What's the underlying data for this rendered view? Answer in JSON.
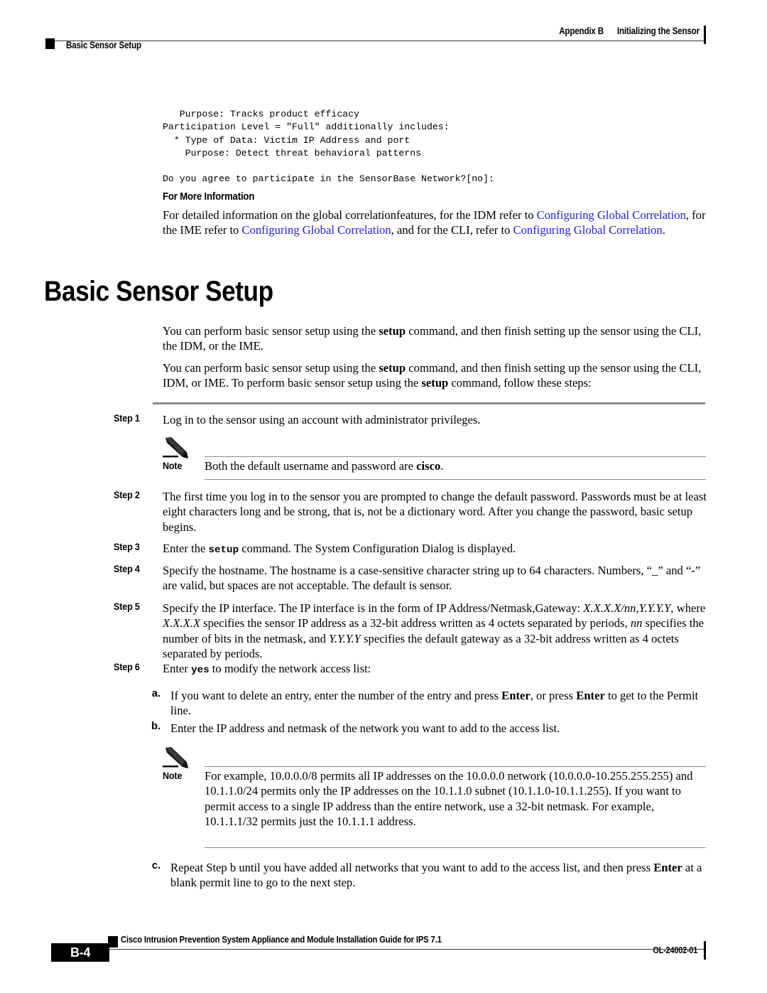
{
  "header": {
    "appendix_label": "Appendix B",
    "appendix_title": "Initializing the Sensor",
    "running_head": "Basic Sensor Setup"
  },
  "code_block": {
    "text": "   Purpose: Tracks product efficacy\nParticipation Level = \"Full\" additionally includes:\n  * Type of Data: Victim IP Address and port\n    Purpose: Detect threat behavioral patterns\n\nDo you agree to participate in the SensorBase Network?[no]:"
  },
  "for_more_information": {
    "heading": "For More Information",
    "text_1": "For detailed information on the global correlationfeatures, for the IDM refer to ",
    "link_1": "Configuring Global Correlation",
    "text_2": ", for the IME refer to ",
    "link_2": "Configuring Global Correlation",
    "text_3": ", and for the CLI, refer to ",
    "link_3": "Configuring Global Correlation",
    "text_4": ".",
    "link_color": "#2222cc"
  },
  "chapter_title": "Basic Sensor Setup",
  "intro": {
    "para_1_a": "You can perform basic sensor setup using the ",
    "para_1_b": "setup",
    "para_1_c": " command, and then finish setting up the sensor using the CLI, the IDM, or the IME.",
    "para_2_a": "You can perform basic sensor setup using the ",
    "para_2_b": "setup",
    "para_2_c": " command, and then finish setting up the sensor using the CLI, IDM, or IME. To perform basic sensor setup using the ",
    "para_2_d": "setup",
    "para_2_e": " command, follow these steps:"
  },
  "steps": {
    "step1": {
      "label": "Step 1",
      "text": "Log in to the sensor using an account with administrator privileges."
    },
    "step2": {
      "label": "Step 2",
      "text": "The first time you log in to the sensor you are prompted to change the default password. Passwords must be at least eight characters long and be strong, that is, not be a dictionary word. After you change the password, basic setup begins."
    },
    "step3": {
      "label": "Step 3",
      "text_a": "Enter the ",
      "text_b": "setup",
      "text_c": " command. The System Configuration Dialog is displayed."
    },
    "step4": {
      "label": "Step 4",
      "text": "Specify the hostname. The hostname is a case-sensitive character string up to 64 characters. Numbers, “_” and “-” are valid, but spaces are not acceptable. The default is sensor."
    },
    "step5": {
      "label": "Step 5",
      "text_a": "Specify the IP interface. The IP interface is in the form of IP Address/Netmask,Gateway: ",
      "italic_1": "X.X.X.X/nn,Y.Y.Y.Y",
      "text_b": ", where ",
      "italic_2": "X.X.X.X",
      "text_c": " specifies the sensor IP address as a 32-bit address written as 4 octets separated by periods, ",
      "italic_3": "nn",
      "text_d": " specifies the number of bits in the netmask, and ",
      "italic_4": "Y.Y.Y.Y",
      "text_e": " specifies the default gateway as a 32-bit address written as 4 octets separated by periods."
    },
    "step6": {
      "label": "Step 6",
      "text_a": "Enter ",
      "text_b": "yes",
      "text_c": " to modify the network access list:"
    }
  },
  "substeps": {
    "a": {
      "label": "a.",
      "text_a": "If you want to delete an entry, enter the number of the entry and press ",
      "text_b": "Enter",
      "text_c": ", or press ",
      "text_d": "Enter",
      "text_e": " to get to the Permit line."
    },
    "b": {
      "label": "b.",
      "text": "Enter the IP address and netmask of the network you want to add to the access list."
    },
    "c": {
      "label": "c.",
      "text_a": "Repeat Step b until you have added all networks that you want to add to the access list, and then press ",
      "text_b": "Enter",
      "text_c": " at a blank permit line to go to the next step."
    }
  },
  "notes": {
    "note1": {
      "label": "Note",
      "icon": "pencil-icon",
      "text_a": "Both the default username and password are ",
      "text_b": "cisco",
      "text_c": "."
    },
    "note2": {
      "label": "Note",
      "icon": "pencil-icon",
      "text": "For example, 10.0.0.0/8 permits all IP addresses on the 10.0.0.0 network (10.0.0.0-10.255.255.255) and 10.1.1.0/24 permits only the IP addresses on the 10.1.1.0 subnet (10.1.1.0-10.1.1.255). If you want to permit access to a single IP address than the entire network, use a 32-bit netmask. For example, 10.1.1.1/32 permits just the 10.1.1.1 address."
    }
  },
  "footer": {
    "doc_title": "Cisco Intrusion Prevention System Appliance and Module Installation Guide for IPS 7.1",
    "page_number": "B-4",
    "doc_id": "OL-24002-01"
  }
}
